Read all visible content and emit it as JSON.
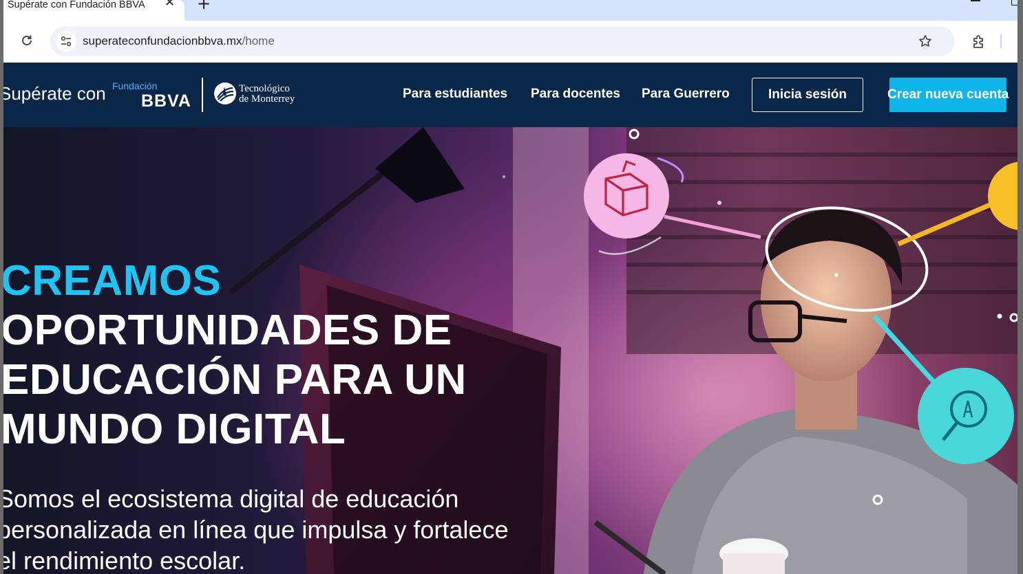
{
  "browser": {
    "tab_title": "Supérate con Fundación BBVA",
    "url_domain": "superateconfundacionbbva.mx",
    "url_path": "/home"
  },
  "site": {
    "brand_prefix": "Supérate con",
    "brand_fundacion": "Fundación",
    "brand_bbva": "BBVA",
    "tec_line1": "Tecnológico",
    "tec_line2": "de Monterrey",
    "nav": [
      "Para estudiantes",
      "Para docentes",
      "Para Guerrero"
    ],
    "login_label": "Inicia sesión",
    "create_label": "Crear nueva cuenta"
  },
  "hero": {
    "accent": "CREAMOS",
    "lines": [
      "OPORTUNIDADES DE",
      "EDUCACIÓN PARA UN",
      "MUNDO DIGITAL"
    ],
    "paragraph": "Somos el ecosistema digital de educación personalizada en línea que impulsa y fortalece el rendimiento escolar."
  },
  "colors": {
    "nav_bg": "#0a2648",
    "accent": "#20c4f2",
    "create_button": "#0fb5ea",
    "tabstrip": "#d3e3fd"
  }
}
